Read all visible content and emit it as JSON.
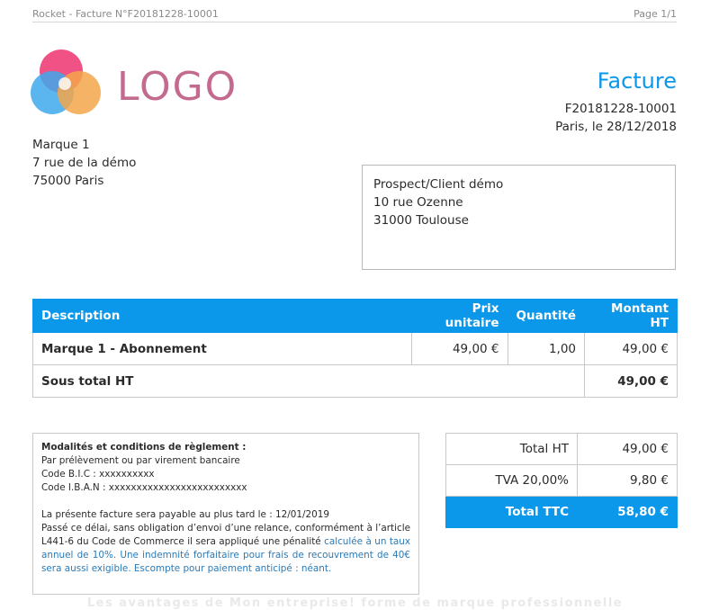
{
  "page_header": {
    "title": "Rocket - Facture N°F20181228-10001",
    "page": "Page 1/1"
  },
  "logo": {
    "text": "LOGO"
  },
  "invoice": {
    "title": "Facture",
    "number": "F20181228-10001",
    "place_date": "Paris, le 28/12/2018"
  },
  "sender": {
    "name": "Marque 1",
    "street": "7 rue de la démo",
    "city": "75000 Paris"
  },
  "client": {
    "name": "Prospect/Client démo",
    "street": "10 rue Ozenne",
    "city": "31000 Toulouse"
  },
  "items": {
    "headers": {
      "description": "Description",
      "unit_price": "Prix unitaire",
      "quantity": "Quantité",
      "amount": "Montant HT"
    },
    "rows": [
      {
        "description": "Marque 1 - Abonnement",
        "unit_price": "49,00 €",
        "quantity": "1,00",
        "amount": "49,00 €"
      }
    ],
    "subtotal_label": "Sous total HT",
    "subtotal_value": "49,00 €"
  },
  "conditions": {
    "title": "Modalités et conditions de règlement :",
    "line1": "Par prélèvement ou par virement bancaire",
    "bic": "Code B.I.C : xxxxxxxxxx",
    "iban": "Code I.B.A.N : xxxxxxxxxxxxxxxxxxxxxxxxx",
    "due": "La présente facture sera payable au plus tard le : 12/01/2019",
    "penalty": "Passé ce délai, sans obligation d’envoi d’une relance, conformément à l’article L441-6 du Code de Commerce il sera appliqué une pénalité",
    "penalty_blue": "calculée à un taux annuel de 10%. Une indemnité forfaitaire pour frais de recouvrement de 40€ sera aussi exigible. Escompte pour paiement anticipé : néant."
  },
  "totals": {
    "ht_label": "Total HT",
    "ht_value": "49,00 €",
    "tva_label": "TVA 20,00%",
    "tva_value": "9,80 €",
    "ttc_label": "Total TTC",
    "ttc_value": "58,80 €"
  },
  "footer": {
    "text": "Les avantages de Mon entreprise! forme de marque professionnelle"
  },
  "colors": {
    "accent": "#0b97ea",
    "logo_pink": "#ef3f78",
    "logo_blue": "#3ea8ec",
    "logo_orange": "#f3a64a"
  }
}
